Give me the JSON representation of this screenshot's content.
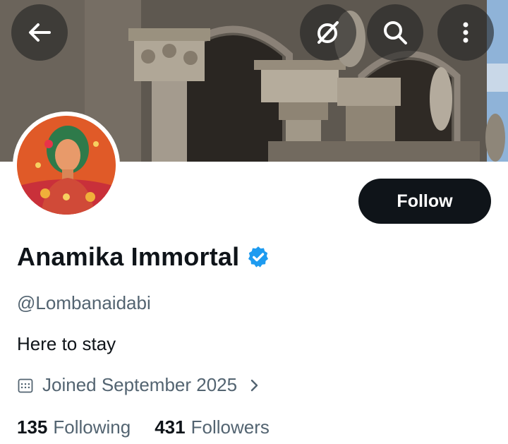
{
  "profile": {
    "display_name": "Anamika Immortal",
    "handle": "@Lombanaidabi",
    "bio": "Here to stay",
    "joined": "Joined September 2025",
    "following_count": "135",
    "following_label": "Following",
    "followers_count": "431",
    "followers_label": "Followers",
    "verified": true
  },
  "actions": {
    "follow_label": "Follow"
  },
  "icons": {
    "back": "arrow-left-icon",
    "grok": "grok-icon",
    "search": "search-icon",
    "more": "more-vertical-icon",
    "verified": "verified-badge-icon",
    "calendar": "calendar-icon",
    "chevron": "chevron-right-icon"
  },
  "colors": {
    "verified": "#1d9bf0",
    "follow_button_bg": "#0f1419",
    "secondary_text": "#536471"
  }
}
